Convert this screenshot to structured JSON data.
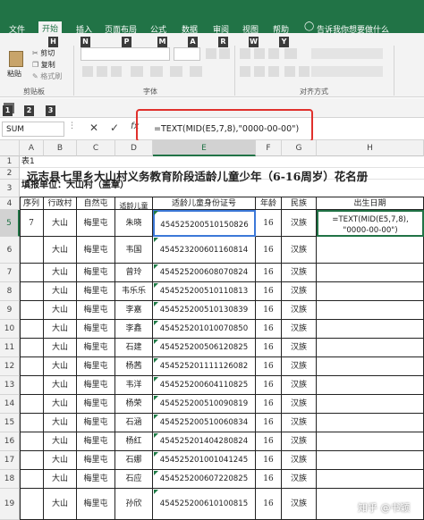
{
  "ribbon": {
    "tabs": [
      "文件",
      "开始",
      "插入",
      "页面布局",
      "公式",
      "数据",
      "审阅",
      "视图",
      "帮助"
    ],
    "tell": "告诉我你想要做什么",
    "keytips": [
      "H",
      "N",
      "P",
      "M",
      "A",
      "R",
      "W",
      "Y"
    ],
    "clipboard": {
      "paste": "粘贴",
      "cut": "剪切",
      "copy": "复制",
      "format": "格式刷",
      "label": "剪贴板"
    },
    "font_label": "字体",
    "align_label": "对齐方式"
  },
  "qat": {
    "keytips": [
      "1",
      "2",
      "3"
    ]
  },
  "formula_bar": {
    "name_box": "SUM",
    "formula": "=TEXT(MID(E5,7,8),\"0000-00-00\")",
    "formula_ref": "E5"
  },
  "columns": [
    "A",
    "B",
    "C",
    "D",
    "E",
    "F",
    "G",
    "H"
  ],
  "rows": [
    "1",
    "2",
    "3",
    "4",
    "5",
    "6",
    "7",
    "8",
    "9",
    "10",
    "11",
    "12",
    "13",
    "14",
    "15",
    "16",
    "17",
    "18",
    "19"
  ],
  "sheet": {
    "a1": "表1",
    "title": "远志县七里乡大山村义务教育阶段适龄儿童少年（6-16周岁）花名册",
    "unit": "填报单位：大山村（盖章）",
    "headers": [
      "序列",
      "行政村",
      "自然屯",
      "适龄儿童姓名",
      "适龄儿童身份证号",
      "年龄",
      "民族",
      "出生日期"
    ],
    "edit_line1": "=TEXT(MID(E5,7,8),",
    "edit_line2": "\"0000-00-00\")",
    "records": [
      [
        "7",
        "大山",
        "梅里屯",
        "朱晓",
        "454525200510150826",
        "16",
        "汉族"
      ],
      [
        "",
        "大山",
        "梅里屯",
        "韦国",
        "454523200601160814",
        "16",
        "汉族"
      ],
      [
        "",
        "大山",
        "梅里屯",
        "曾玲",
        "454525200608070824",
        "16",
        "汉族"
      ],
      [
        "",
        "大山",
        "梅里屯",
        "韦乐乐",
        "454525200510110813",
        "16",
        "汉族"
      ],
      [
        "",
        "大山",
        "梅里屯",
        "李嘉",
        "454525200510130839",
        "16",
        "汉族"
      ],
      [
        "",
        "大山",
        "梅里屯",
        "李鑫",
        "454525201010070850",
        "16",
        "汉族"
      ],
      [
        "",
        "大山",
        "梅里屯",
        "石建",
        "454525200506120825",
        "16",
        "汉族"
      ],
      [
        "",
        "大山",
        "梅里屯",
        "杨茜",
        "454525201111126082",
        "16",
        "汉族"
      ],
      [
        "",
        "大山",
        "梅里屯",
        "韦洋",
        "454525200604110825",
        "16",
        "汉族"
      ],
      [
        "",
        "大山",
        "梅里屯",
        "杨荣",
        "454525200510090819",
        "16",
        "汉族"
      ],
      [
        "",
        "大山",
        "梅里屯",
        "石涵",
        "454525200510060834",
        "16",
        "汉族"
      ],
      [
        "",
        "大山",
        "梅里屯",
        "杨红",
        "454525201404280824",
        "16",
        "汉族"
      ],
      [
        "",
        "大山",
        "梅里屯",
        "石娜",
        "454525201001041245",
        "16",
        "汉族"
      ],
      [
        "",
        "大山",
        "梅里屯",
        "石应",
        "454525200607220825",
        "16",
        "汉族"
      ],
      [
        "",
        "大山",
        "梅里屯",
        "孙欣",
        "454525200610100815",
        "16",
        "汉族"
      ]
    ]
  },
  "watermark": "知乎 @书颖"
}
